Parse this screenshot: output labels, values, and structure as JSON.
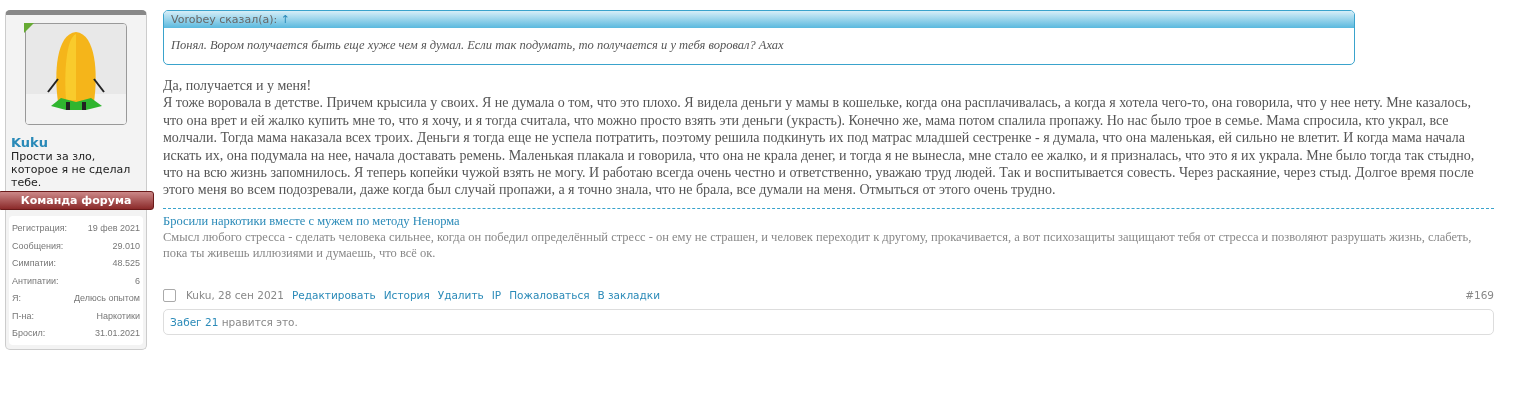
{
  "user": {
    "name": "Kuku",
    "title": "Прости за зло, которое я не сделал тебе.",
    "banner": "Команда форума",
    "stats": [
      {
        "label": "Регистрация:",
        "value": "19 фев 2021"
      },
      {
        "label": "Сообщения:",
        "value": "29.010"
      },
      {
        "label": "Симпатии:",
        "value": "48.525"
      },
      {
        "label": "Антипатии:",
        "value": "6"
      },
      {
        "label": "Я:",
        "value": "Делюсь опытом"
      },
      {
        "label": "П-на:",
        "value": "Наркотики"
      },
      {
        "label": "Бросил:",
        "value": "31.01.2021"
      }
    ]
  },
  "quote": {
    "author": "Vorobey сказал(а):",
    "jump": "↑",
    "text": "Понял. Вором получается быть еще хуже чем я думал. Если так подумать, то получается и у тебя воровал? Ахах"
  },
  "message": [
    "Да, получается и у меня!",
    "Я тоже воровала в детстве. Причем крысила у своих. Я не думала о том, что это плохо. Я видела деньги у мамы в кошельке, когда она расплачивалась, а когда я хотела чего-то, она говорила, что у нее нету. Мне казалось, что она врет и ей жалко купить мне то, что я хочу, и я тогда считала, что можно просто взять эти деньги (украсть). Конечно же, мама потом спалила пропажу. Но нас было трое в семье. Мама спросила, кто украл, все молчали. Тогда мама наказала всех троих. Деньги я тогда еще не успела потратить, поэтому решила подкинуть их под матрас младшей сестренке - я думала, что она маленькая, ей сильно не влетит. И когда мама начала искать их, она подумала на нее, начала доставать ремень. Маленькая плакала и говорила, что она не крала денег, и тогда я не вынесла, мне стало ее жалко, и я призналась, что это я их украла. Мне было тогда так стыдно, что на всю жизнь запомнилось. Я теперь копейки чужой взять не могу. И работаю всегда очень честно и ответственно, уважаю труд людей. Так и воспитывается совесть. Через раскаяние, через стыд. Долгое время после этого меня во всем подозревали, даже когда был случай пропажи, а я точно знала, что не брала, все думали на меня. Отмыться от этого очень трудно."
  ],
  "signature": {
    "link": "Бросили наркотики вместе с мужем по методу Ненорма",
    "text": "Смысл любого стресса - сделать человека сильнее, когда он победил определённый стресс - он ему не страшен, и человек переходит к другому, прокачивается, а вот психозащиты защищают тебя от стресса и позволяют разрушать жизнь, слабеть, пока ты живешь иллюзиями и думаешь, что всё ок."
  },
  "footer": {
    "checked": false,
    "author_date": "Kuku, 28 сен 2021",
    "actions": [
      "Редактировать",
      "История",
      "Удалить",
      "IP",
      "Пожаловаться",
      "В закладки"
    ],
    "post_number": "#169"
  },
  "likes": {
    "user": "Забег 21",
    "text": " нравится это."
  }
}
